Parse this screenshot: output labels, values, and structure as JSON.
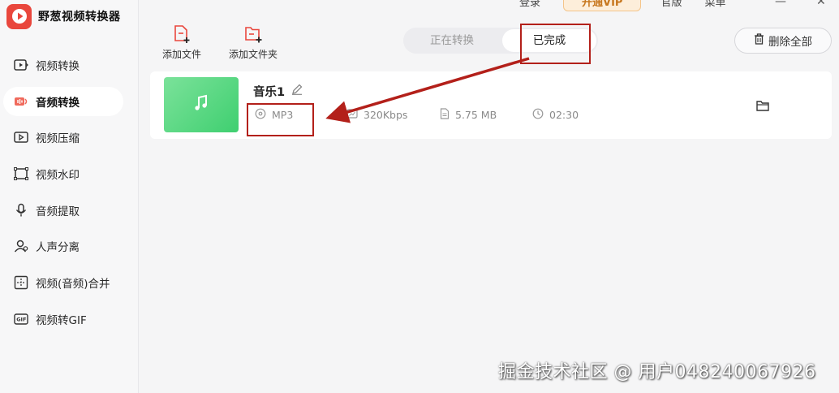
{
  "app": {
    "title": "野葱视频转换器"
  },
  "topbar": {
    "login": "登录",
    "vip": "开通VIP",
    "version": "官版",
    "menu": "菜单"
  },
  "sidebar": {
    "items": [
      {
        "label": "视频转换",
        "icon": "video-convert-icon"
      },
      {
        "label": "音频转换",
        "icon": "audio-convert-icon",
        "active": true
      },
      {
        "label": "视频压缩",
        "icon": "video-compress-icon"
      },
      {
        "label": "视频水印",
        "icon": "watermark-icon"
      },
      {
        "label": "音频提取",
        "icon": "audio-extract-icon"
      },
      {
        "label": "人声分离",
        "icon": "voice-separate-icon"
      },
      {
        "label": "视频(音频)合并",
        "icon": "merge-icon"
      },
      {
        "label": "视频转GIF",
        "icon": "gif-icon"
      }
    ]
  },
  "toolbar": {
    "add_file": "添加文件",
    "add_folder": "添加文件夹",
    "delete_all": "删除全部"
  },
  "tabs": [
    {
      "label": "正在转换"
    },
    {
      "label": "已完成",
      "active": true
    }
  ],
  "file": {
    "name": "音乐1",
    "format": "MP3",
    "bitrate": "320Kbps",
    "size": "5.75 MB",
    "duration": "02:30"
  },
  "watermark": "掘金技术社区 @ 用户048240067926",
  "colors": {
    "accent": "#e9473d",
    "annotation": "#b3201a",
    "thumb": "#4fd67c"
  }
}
